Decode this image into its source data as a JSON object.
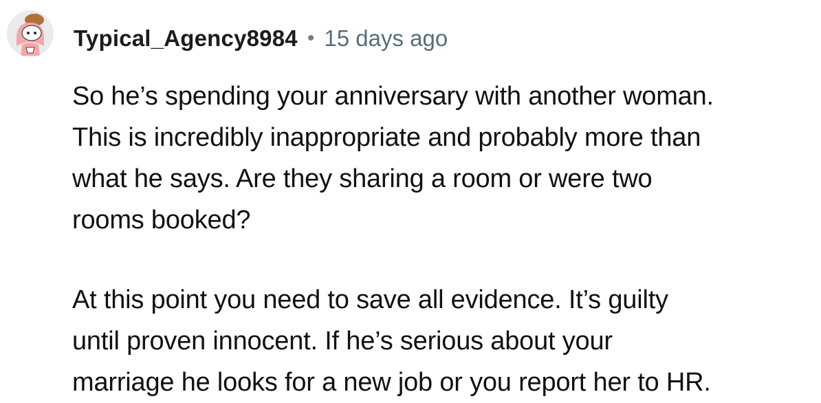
{
  "comment": {
    "username": "Typical_Agency8984",
    "separator": "•",
    "timestamp": "15 days ago",
    "avatar_icon": "snoo-avatar-icon",
    "paragraphs": [
      {
        "lines": [
          "So he’s spending your anniversary with another woman.",
          "This is incredibly inappropriate and probably more than",
          "what he says. Are they sharing a room or were two",
          "rooms booked?"
        ]
      },
      {
        "lines": [
          "At this point you need to save all evidence. It’s guilty",
          "until proven innocent. If he’s serious about your",
          "marriage he looks for a new job or you report her to HR."
        ]
      }
    ]
  },
  "colors": {
    "username": "#1c1c1c",
    "timestamp": "#576f76",
    "body_text": "#111111",
    "avatar_bg": "#e9ecef",
    "avatar_accent": "#b0713a"
  }
}
